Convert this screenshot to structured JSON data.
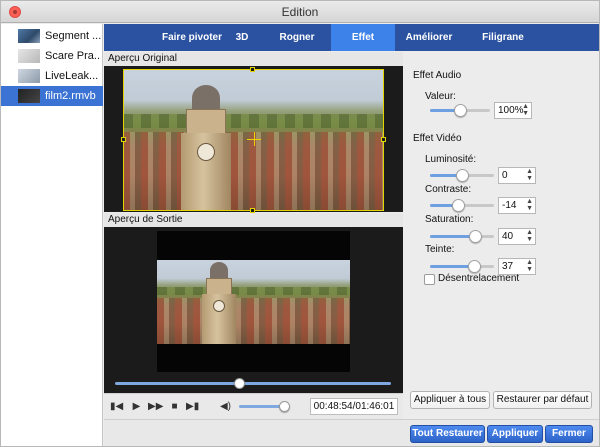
{
  "window": {
    "title": "Edition"
  },
  "sidebar": {
    "items": [
      {
        "label": "Segment ...",
        "selected": false
      },
      {
        "label": "Scare Pra...",
        "selected": false
      },
      {
        "label": "LiveLeak...",
        "selected": false
      },
      {
        "label": "film2.rmvb",
        "selected": true
      }
    ]
  },
  "tabs": [
    {
      "label": "Faire pivoter",
      "active": false
    },
    {
      "label": "3D",
      "active": false
    },
    {
      "label": "Rogner",
      "active": false
    },
    {
      "label": "Effet",
      "active": true
    },
    {
      "label": "Améliorer",
      "active": false
    },
    {
      "label": "Filigrane",
      "active": false
    }
  ],
  "preview": {
    "original_label": "Aperçu Original",
    "output_label": "Aperçu de Sortie",
    "seek_position": 0.45
  },
  "playback": {
    "time": "00:48:54/01:46:01",
    "volume": 0.9,
    "icons": [
      "skip-back-icon",
      "play-icon",
      "fast-forward-icon",
      "stop-icon",
      "skip-forward-icon",
      "volume-icon"
    ]
  },
  "audio_effect": {
    "title": "Effet Audio",
    "value_label": "Valeur:",
    "value": "100%",
    "level": 0.5
  },
  "video_effect": {
    "title": "Effet Vidéo",
    "brightness": {
      "label": "Luminosité:",
      "value": "0",
      "level": 0.5
    },
    "contrast": {
      "label": "Contraste:",
      "value": "-14",
      "level": 0.43
    },
    "saturation": {
      "label": "Saturation:",
      "value": "40",
      "level": 0.7
    },
    "hue": {
      "label": "Teinte:",
      "value": "37",
      "level": 0.68
    },
    "deinterlace": {
      "label": "Désentrelacement",
      "checked": false
    }
  },
  "buttons": {
    "apply_all": "Appliquer à tous",
    "restore_default": "Restaurer par défaut",
    "restore_all": "Tout Restaurer",
    "apply": "Appliquer",
    "close": "Fermer"
  },
  "colors": {
    "tab_bar": "#2a52a0",
    "tab_active": "#3d82e8",
    "selection": "#3b73d4",
    "crop_frame": "#e3d400",
    "slider_fill": "#6e9fe0"
  }
}
